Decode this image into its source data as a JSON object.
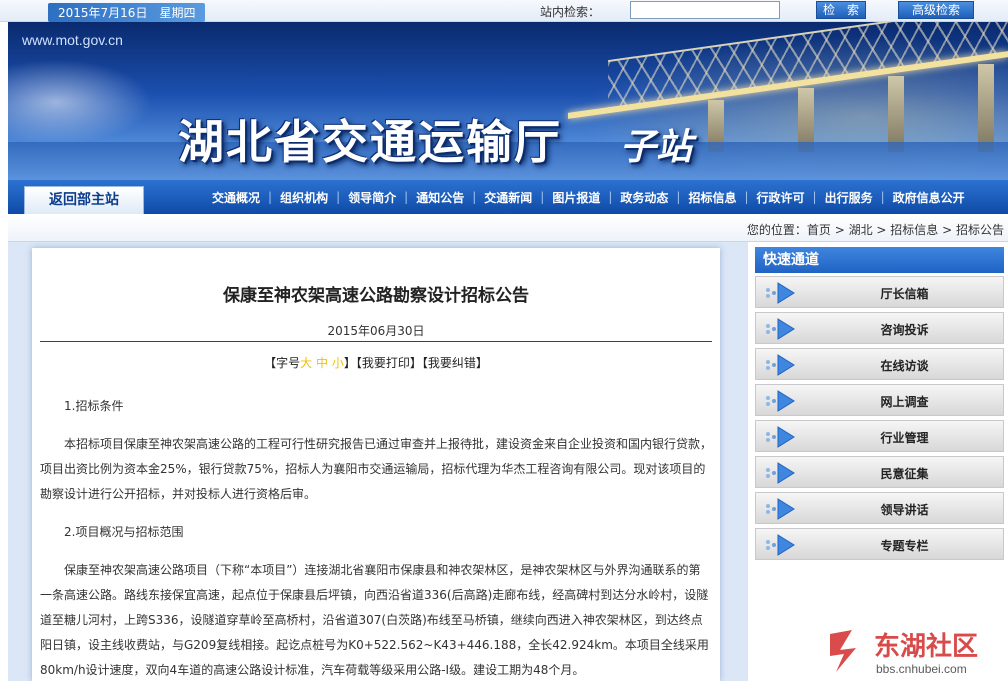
{
  "topbar": {
    "date": "2015年7月16日　星期四",
    "search_label": "站内检索：",
    "search_value": "",
    "search_button": "检　索",
    "advanced_button": "高级检索"
  },
  "banner": {
    "url": "www.mot.gov.cn",
    "title": "湖北省交通运输厅",
    "subtitle": "子站"
  },
  "nav": {
    "back_main": "返回部主站",
    "items": [
      "交通概况",
      "组织机构",
      "领导简介",
      "通知公告",
      "交通新闻",
      "图片报道",
      "政务动态",
      "招标信息",
      "行政许可",
      "出行服务",
      "政府信息公开"
    ]
  },
  "breadcrumb": {
    "prefix": "您的位置：",
    "items": [
      "首页",
      "湖北",
      "招标信息",
      "招标公告"
    ]
  },
  "article": {
    "title": "保康至神农架高速公路勘察设计招标公告",
    "date": "2015年06月30日",
    "tools": {
      "font_label": "【字号",
      "size_large": "大",
      "size_medium": "中",
      "size_small": "小",
      "close_bracket": "】",
      "print": "【我要打印】",
      "correct": "【我要纠错】"
    },
    "sections": [
      {
        "heading": "1.招标条件",
        "paragraph": "本招标项目保康至神农架高速公路的工程可行性研究报告已通过审查并上报待批，建设资金来自企业投资和国内银行贷款，项目出资比例为资本金25%，银行贷款75%，招标人为襄阳市交通运输局，招标代理为华杰工程咨询有限公司。现对该项目的勘察设计进行公开招标，并对投标人进行资格后审。"
      },
      {
        "heading": "2.项目概况与招标范围",
        "paragraph": "保康至神农架高速公路项目（下称“本项目”）连接湖北省襄阳市保康县和神农架林区，是神农架林区与外界沟通联系的第一条高速公路。路线东接保宜高速，起点位于保康县后坪镇，向西沿省道336(后高路)走廊布线，经高碑村到达分水岭村，设隧道至糖儿河村，上跨S336，设隧道穿草岭至高桥村，沿省道307(白茨路)布线至马桥镇，继续向西进入神农架林区，到达终点阳日镇，设主线收费站，与G209复线相接。起讫点桩号为K0+522.562~K43+446.188，全长42.924km。本项目全线采用80km/h设计速度，双向4车道的高速公路设计标准，汽车荷载等级采用公路-Ⅰ级。建设工期为48个月。"
      }
    ]
  },
  "sidebar": {
    "title": "快速通道",
    "items": [
      "厅长信箱",
      "咨询投诉",
      "在线访谈",
      "网上调查",
      "行业管理",
      "民意征集",
      "领导讲话",
      "专题专栏"
    ]
  },
  "watermark": {
    "text": "东湖社区",
    "url": "bbs.cnhubei.com"
  },
  "colors": {
    "nav_bg": "#1f5fbf",
    "sidebar_title_bg": "#2e75d6",
    "article_rule": "#2c3f8e",
    "watermark": "#d32b2b"
  }
}
